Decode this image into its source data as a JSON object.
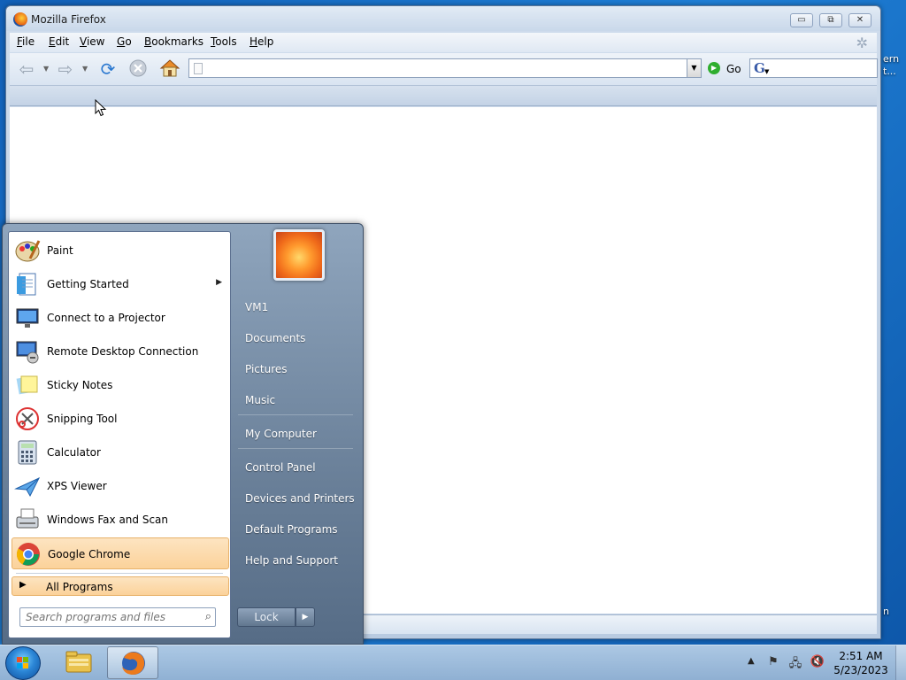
{
  "desktop": {
    "edge_texts": [
      "ern",
      "t...",
      "n"
    ]
  },
  "firefox": {
    "title": "Mozilla Firefox",
    "window_buttons": {
      "minimize": "▭",
      "maximize": "⧉",
      "close": "✕"
    },
    "menu": [
      "File",
      "Edit",
      "View",
      "Go",
      "Bookmarks",
      "Tools",
      "Help"
    ],
    "url_value": "",
    "go_label": "Go",
    "search_engine_letter": "G",
    "search_value": ""
  },
  "start_menu": {
    "programs": [
      {
        "label": "Paint",
        "icon": "paint-icon",
        "submenu": false
      },
      {
        "label": "Getting Started",
        "icon": "getting-started-icon",
        "submenu": true
      },
      {
        "label": "Connect to a Projector",
        "icon": "projector-icon",
        "submenu": false
      },
      {
        "label": "Remote Desktop Connection",
        "icon": "remote-desktop-icon",
        "submenu": false
      },
      {
        "label": "Sticky Notes",
        "icon": "sticky-notes-icon",
        "submenu": false
      },
      {
        "label": "Snipping Tool",
        "icon": "snipping-tool-icon",
        "submenu": false
      },
      {
        "label": "Calculator",
        "icon": "calculator-icon",
        "submenu": false
      },
      {
        "label": "XPS Viewer",
        "icon": "xps-viewer-icon",
        "submenu": false
      },
      {
        "label": "Windows Fax and Scan",
        "icon": "fax-scan-icon",
        "submenu": false
      },
      {
        "label": "Google Chrome",
        "icon": "chrome-icon",
        "submenu": false,
        "highlighted": true
      }
    ],
    "all_programs_label": "All Programs",
    "search_placeholder": "Search programs and files",
    "right_items": [
      "VM1",
      "Documents",
      "Pictures",
      "Music",
      "My Computer",
      "Control Panel",
      "Devices and Printers",
      "Default Programs",
      "Help and Support"
    ],
    "lock_label": "Lock"
  },
  "taskbar": {
    "time": "2:51 AM",
    "date": "5/23/2023"
  },
  "colors": {
    "highlight": "#fbd29a",
    "taskbar": "#a9c3df",
    "desktop": "#1f7fd6"
  }
}
